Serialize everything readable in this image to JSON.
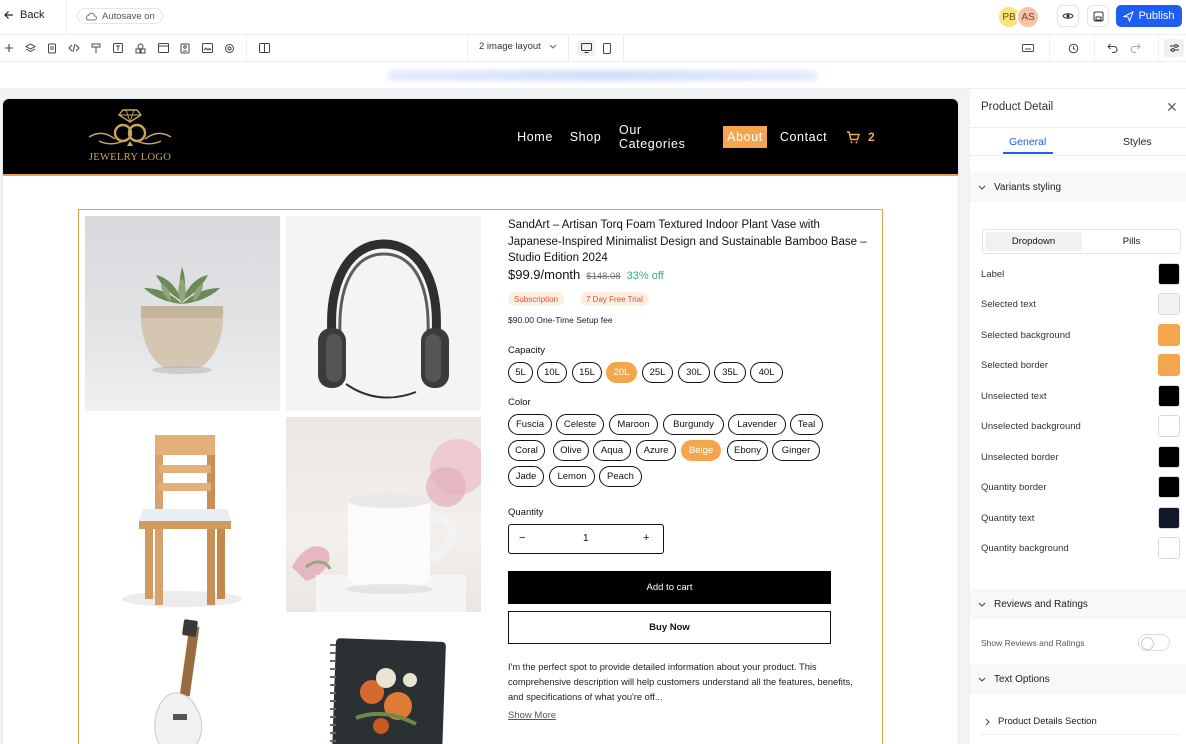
{
  "topbar": {
    "back_label": "Back",
    "autosave_label": "Autosave on",
    "avatars": [
      "PB",
      "AS"
    ],
    "publish_label": "Publish"
  },
  "toolbar": {
    "layout_label": "2 image layout"
  },
  "colors": {
    "accent": "#f4a64f",
    "primary": "#1e5ef3",
    "border_orange": "#e9a04d"
  },
  "site": {
    "logo_text": "JEWELRY LOGO",
    "nav": [
      "Home",
      "Shop",
      "Our Categories",
      "About",
      "Contact"
    ],
    "active_nav": "About",
    "cart_count": "2"
  },
  "product": {
    "title": "SandArt – Artisan Torq Foam Textured Indoor Plant Vase with Japanese-Inspired Minimalist Design and Sustainable Bamboo Base – Studio Edition 2024",
    "price": "$99.9/month",
    "old_price": "$148.08",
    "discount": "33% off",
    "tags": [
      "Subscription",
      "7 Day Free Trial"
    ],
    "setup_fee": "$90.00 One-Time Setup fee",
    "capacity_label": "Capacity",
    "capacity_options": [
      "5L",
      "10L",
      "15L",
      "20L",
      "25L",
      "30L",
      "35L",
      "40L"
    ],
    "capacity_selected": "20L",
    "color_label": "Color",
    "color_options": [
      "Fuscia",
      "Celeste",
      "Maroon",
      "Burgundy",
      "Lavender",
      "Teal",
      "Coral",
      "Olive",
      "Aqua",
      "Azure",
      "Beige",
      "Ebony",
      "Ginger",
      "Jade",
      "Lemon",
      "Peach"
    ],
    "color_selected": "Beige",
    "quantity_label": "Quantity",
    "quantity_value": "1",
    "add_to_cart": "Add to cart",
    "buy_now": "Buy Now",
    "description": "I'm the perfect spot to provide detailed information about your product. This comprehensive description will help customers understand all the features, benefits, and specifications of what you're off...",
    "show_more": "Show More"
  },
  "panel": {
    "title": "Product Detail",
    "tabs": [
      "General",
      "Styles"
    ],
    "variants_section": "Variants styling",
    "variant_modes": [
      "Dropdown",
      "Pills"
    ],
    "colors_rows": [
      {
        "label": "Label",
        "color": "#000000"
      },
      {
        "label": "Selected text",
        "color": "#f2f2f2"
      },
      {
        "label": "Selected background",
        "color": "#f4a64f"
      },
      {
        "label": "Selected border",
        "color": "#f4a64f"
      },
      {
        "label": "Unselected text",
        "color": "#000000"
      },
      {
        "label": "Unselected background",
        "color": "#ffffff"
      },
      {
        "label": "Unselected border",
        "color": "#000000"
      },
      {
        "label": "Quantity border",
        "color": "#000000"
      },
      {
        "label": "Quantity text",
        "color": "#0f1729"
      },
      {
        "label": "Quantity background",
        "color": "#ffffff"
      }
    ],
    "reviews_section": "Reviews and Ratings",
    "show_reviews_label": "Show Reviews and Ratings",
    "text_options_section": "Text Options",
    "product_details_section": "Product Details Section"
  }
}
